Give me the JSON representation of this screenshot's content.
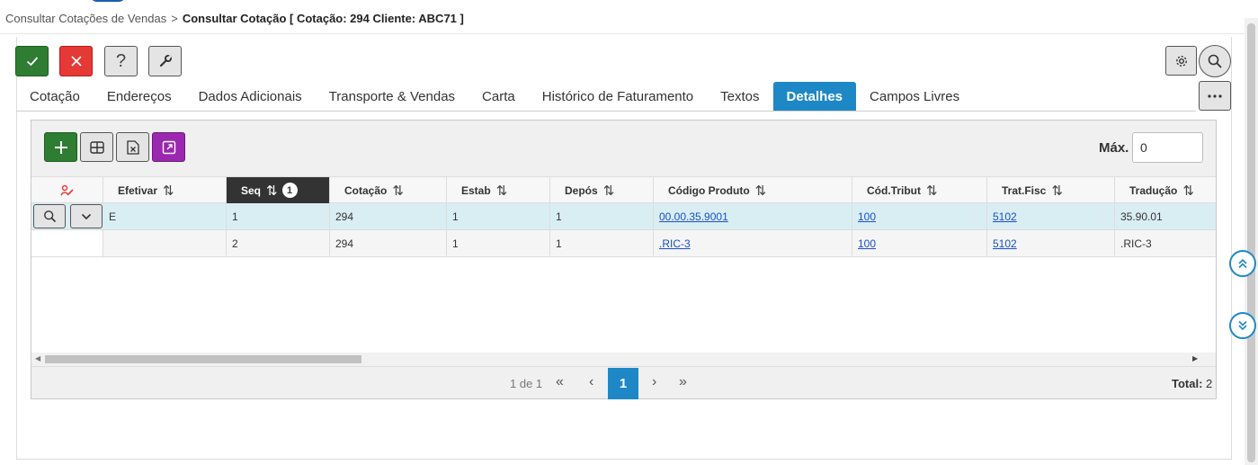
{
  "breadcrumb": {
    "parent": "Consultar Cotações de Vendas",
    "separator": ">",
    "current": "Consultar Cotação [ Cotação: 294 Cliente: ABC71 ]"
  },
  "toolbar": {
    "help_label": "?"
  },
  "tabs": [
    {
      "label": "Cotação"
    },
    {
      "label": "Endereços"
    },
    {
      "label": "Dados Adicionais"
    },
    {
      "label": "Transporte & Vendas"
    },
    {
      "label": "Carta"
    },
    {
      "label": "Histórico de Faturamento"
    },
    {
      "label": "Textos"
    },
    {
      "label": "Detalhes",
      "active": true
    },
    {
      "label": "Campos Livres"
    }
  ],
  "grid": {
    "max_label": "Máx.",
    "max_value": "0",
    "columns": [
      {
        "label": "Efetivar",
        "sort": "⇅"
      },
      {
        "label": "Seq",
        "sort": "⇅",
        "badge": "1"
      },
      {
        "label": "Cotação",
        "sort": "⇅"
      },
      {
        "label": "Estab",
        "sort": "⇅"
      },
      {
        "label": "Depós",
        "sort": "⇅"
      },
      {
        "label": "Código Produto",
        "sort": "⇅"
      },
      {
        "label": "Cód.Tribut",
        "sort": "⇅"
      },
      {
        "label": "Trat.Fisc",
        "sort": "⇅"
      },
      {
        "label": "Tradução",
        "sort": "⇅"
      }
    ],
    "rows": [
      {
        "efetivar": "E",
        "seq": "1",
        "cotacao": "294",
        "estab": "1",
        "depos": "1",
        "codigo_produto": "00.00.35.9001",
        "cod_tribut": "100",
        "trat_fisc": "5102",
        "traducao": "35.90.01"
      },
      {
        "efetivar": "",
        "seq": "2",
        "cotacao": "294",
        "estab": "1",
        "depos": "1",
        "codigo_produto": ".RIC-3",
        "cod_tribut": "100",
        "trat_fisc": "5102",
        "traducao": ".RIC-3"
      }
    ]
  },
  "pager": {
    "info": "1 de 1",
    "first": "«",
    "prev": "‹",
    "current": "1",
    "next": "›",
    "last": "»",
    "total_label": "Total:",
    "total_value": "2"
  },
  "colors": {
    "accent": "#1e88c7",
    "ok": "#2e7d32",
    "cancel": "#e53935",
    "export": "#9c27b0",
    "selected_row": "#d9eef3",
    "link": "#1a4fc4"
  }
}
